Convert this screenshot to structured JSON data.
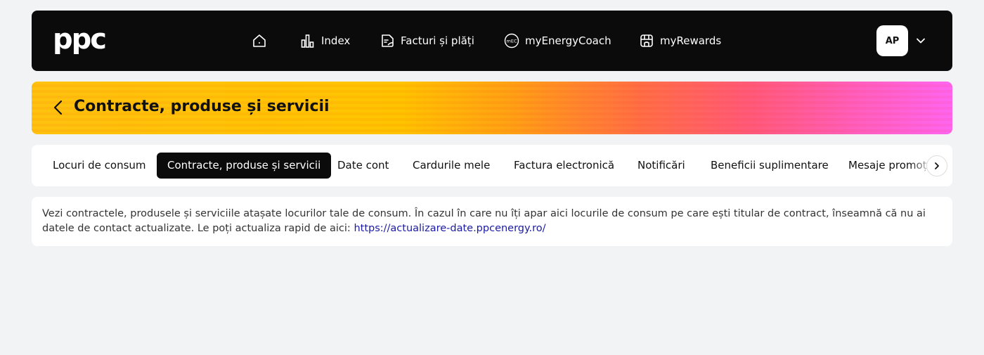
{
  "header": {
    "logo_text": "ppc",
    "nav": [
      {
        "label": "",
        "icon": "home-icon"
      },
      {
        "label": "Index",
        "icon": "bar-chart-icon"
      },
      {
        "label": "Facturi și plăți",
        "icon": "invoice-icon"
      },
      {
        "label": "myEnergyCoach",
        "icon": "energy-coach-icon",
        "icon_text": "mEC"
      },
      {
        "label": "myRewards",
        "icon": "rewards-icon"
      }
    ],
    "avatar_initials": "AP"
  },
  "banner": {
    "title": "Contracte, produse și servicii"
  },
  "tabs": {
    "items": [
      {
        "label": "Locuri de consum"
      },
      {
        "label": "Contracte, produse și servicii",
        "active": true
      },
      {
        "label": "Date cont"
      },
      {
        "label": "Cardurile mele"
      },
      {
        "label": "Factura electronică"
      },
      {
        "label": "Notificări"
      },
      {
        "label": "Beneficii suplimentare"
      },
      {
        "label": "Mesaje promoționale"
      }
    ]
  },
  "info": {
    "text": "Vezi contractele, produsele și serviciile atașate locurilor tale de consum. În cazul în care nu îți apar aici locurile de consum pe care ești titular de contract, înseamnă că nu ai datele de contact actualizate. Le poți actualiza rapid de aici: ",
    "link": "https://actualizare-date.ppcenergy.ro/"
  }
}
